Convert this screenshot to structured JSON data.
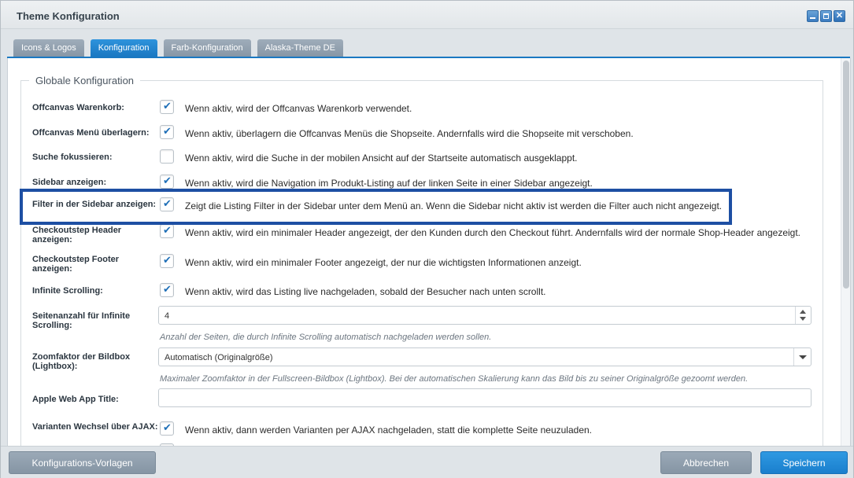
{
  "window": {
    "title": "Theme Konfiguration"
  },
  "tabs": [
    {
      "label": "Icons & Logos",
      "active": false
    },
    {
      "label": "Konfiguration",
      "active": true
    },
    {
      "label": "Farb-Konfiguration",
      "active": false
    },
    {
      "label": "Alaska-Theme DE",
      "active": false
    }
  ],
  "fieldset": {
    "legend": "Globale Konfiguration"
  },
  "settings": [
    {
      "label": "Offcanvas Warenkorb:",
      "checked": true,
      "description": "Wenn aktiv, wird der Offcanvas Warenkorb verwendet."
    },
    {
      "label": "Offcanvas Menü überlagern:",
      "checked": true,
      "description": "Wenn aktiv, überlagern die Offcanvas Menüs die Shopseite. Andernfalls wird die Shopseite mit verschoben."
    },
    {
      "label": "Suche fokussieren:",
      "checked": false,
      "description": "Wenn aktiv, wird die Suche in der mobilen Ansicht auf der Startseite automatisch ausgeklappt."
    },
    {
      "label": "Sidebar anzeigen:",
      "checked": true,
      "description": "Wenn aktiv, wird die Navigation im Produkt-Listing auf der linken Seite in einer Sidebar angezeigt."
    },
    {
      "label": "Filter in der Sidebar anzeigen:",
      "checked": true,
      "description": "Zeigt die Listing Filter in der Sidebar unter dem Menü an. Wenn die Sidebar nicht aktiv ist werden die Filter auch nicht angezeigt."
    },
    {
      "label": "Checkoutstep Header anzeigen:",
      "checked": true,
      "description": "Wenn aktiv, wird ein minimaler Header angezeigt, der den Kunden durch den Checkout führt. Andernfalls wird der normale Shop-Header angezeigt."
    },
    {
      "label": "Checkoutstep Footer anzeigen:",
      "checked": true,
      "description": "Wenn aktiv, wird ein minimaler Footer angezeigt, der nur die wichtigsten Informationen anzeigt."
    },
    {
      "label": "Infinite Scrolling:",
      "checked": true,
      "description": "Wenn aktiv, wird das Listing live nachgeladen, sobald der Besucher nach unten scrollt."
    }
  ],
  "infinite_pages": {
    "label": "Seitenanzahl für Infinite Scrolling:",
    "value": "4",
    "hint": "Anzahl der Seiten, die durch Infinite Scrolling automatisch nachgeladen werden sollen."
  },
  "zoom": {
    "label": "Zoomfaktor der Bildbox (Lightbox):",
    "value": "Automatisch (Originalgröße)",
    "hint": "Maximaler Zoomfaktor in der Fullscreen-Bildbox (Lightbox). Bei der automatischen Skalierung kann das Bild bis zu seiner Originalgröße gezoomt werden."
  },
  "apple_title": {
    "label": "Apple Web App Title:",
    "value": ""
  },
  "variants": {
    "label": "Varianten Wechsel über AJAX:",
    "checked": true,
    "description": "Wenn aktiv, dann werden Varianten per AJAX nachgeladen, statt die komplette Seite neuzuladen."
  },
  "footer": {
    "templates_label": "Konfigurations-Vorlagen",
    "cancel_label": "Abbrechen",
    "save_label": "Speichern"
  }
}
